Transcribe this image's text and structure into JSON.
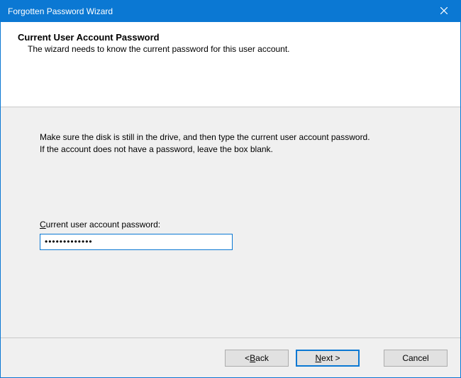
{
  "window": {
    "title": "Forgotten Password Wizard"
  },
  "header": {
    "heading": "Current User Account Password",
    "subtitle": "The wizard needs to know the current password for this user account."
  },
  "body": {
    "instructions": "Make sure the disk is still in the drive, and then type the current user account password. If the account does not have a password, leave the box blank.",
    "field_label_underline": "C",
    "field_label_rest": "urrent user account password:",
    "password_value": "•••••••••••••"
  },
  "footer": {
    "back_prefix": "< ",
    "back_underline": "B",
    "back_rest": "ack",
    "next_underline": "N",
    "next_rest": "ext >",
    "cancel": "Cancel"
  }
}
